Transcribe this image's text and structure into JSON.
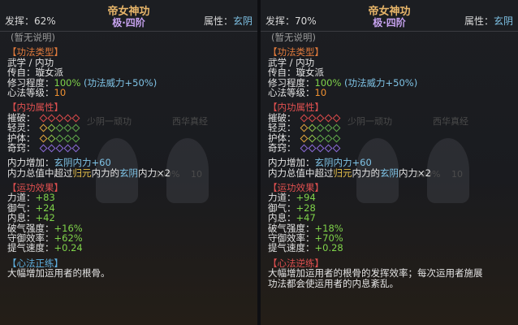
{
  "left": {
    "efficiency_label": "发挥",
    "efficiency": "62%",
    "title": "帝女神功",
    "rank": "极·四阶",
    "attr_label": "属性",
    "attr_value": "玄阴",
    "desc": "(暂无说明)",
    "type_header": "【功法类型】",
    "type_line": "武学 / 内功",
    "origin_label": "传自：",
    "origin_value": "璇女派",
    "cultivation_label": "修习程度：",
    "cultivation_value": "100%",
    "cultivation_note": "(功法威力+50%)",
    "level_label": "心法等级：",
    "level_value": "10",
    "neigong_header": "【内功属性】",
    "neigong_rows": [
      {
        "label": "摧破：",
        "colors": [
          "#d94a4a",
          "#d94a4a",
          "#d94a4a",
          "#d94a4a",
          "#d94a4a"
        ]
      },
      {
        "label": "轻灵：",
        "colors": [
          "#dfa33c",
          "#8fc34a",
          "#5fa84a",
          "#5fa84a",
          "#5fa84a"
        ]
      },
      {
        "label": "护体：",
        "colors": [
          "#dfa33c",
          "#8fc34a",
          "#5fa84a",
          "#5fa84a",
          "#5fa84a"
        ]
      },
      {
        "label": "奇窍：",
        "colors": [
          "#8a6ad6",
          "#8a6ad6",
          "#8a6ad6",
          "#8a6ad6",
          "#8a6ad6"
        ]
      }
    ],
    "neili_label": "内力增加：",
    "neili_value": "玄阴内力+60",
    "neili_line_a": "内力总值中超过",
    "neili_line_b": "归元",
    "neili_line_c": "内力的",
    "neili_line_d": "玄阴",
    "neili_line_e": "内力×2",
    "yungong_header": "【运功效果】",
    "stats": [
      {
        "label": "力道：",
        "value": "+83"
      },
      {
        "label": "御气：",
        "value": "+24"
      },
      {
        "label": "内息：",
        "value": "+42"
      },
      {
        "label": "破气强度：",
        "value": "+16%"
      },
      {
        "label": "守御效率：",
        "value": "+62%"
      },
      {
        "label": "提气速度：",
        "value": "+0.24"
      }
    ],
    "xinfa_header": "【心法正练】",
    "xinfa_text": "大幅增加运用者的根骨。",
    "bg_labels": []
  },
  "right": {
    "efficiency_label": "发挥",
    "efficiency": "70%",
    "title": "帝女神功",
    "rank": "极·四阶",
    "attr_label": "属性",
    "attr_value": "玄阴",
    "desc": "(暂无说明)",
    "type_header": "【功法类型】",
    "type_line": "武学 / 内功",
    "origin_label": "传自：",
    "origin_value": "璇女派",
    "cultivation_label": "修习程度：",
    "cultivation_value": "100%",
    "cultivation_note": "(功法威力+50%)",
    "level_label": "心法等级：",
    "level_value": "10",
    "neigong_header": "【内功属性】",
    "neigong_rows": [
      {
        "label": "摧破：",
        "colors": [
          "#d94a4a",
          "#d94a4a",
          "#d94a4a",
          "#d94a4a",
          "#d94a4a"
        ]
      },
      {
        "label": "轻灵：",
        "colors": [
          "#dfa33c",
          "#8fc34a",
          "#5fa84a",
          "#5fa84a",
          "#5fa84a"
        ]
      },
      {
        "label": "护体：",
        "colors": [
          "#dfa33c",
          "#8fc34a",
          "#5fa84a",
          "#5fa84a",
          "#5fa84a"
        ]
      },
      {
        "label": "奇窍：",
        "colors": [
          "#8a6ad6",
          "#8a6ad6",
          "#8a6ad6",
          "#8a6ad6",
          "#8a6ad6"
        ]
      }
    ],
    "neili_label": "内力增加：",
    "neili_value": "玄阴内力+60",
    "neili_line_a": "内力总值中超过",
    "neili_line_b": "归元",
    "neili_line_c": "内力的",
    "neili_line_d": "玄阴",
    "neili_line_e": "内力×2",
    "yungong_header": "【运功效果】",
    "stats": [
      {
        "label": "力道：",
        "value": "+94"
      },
      {
        "label": "御气：",
        "value": "+28"
      },
      {
        "label": "内息：",
        "value": "+47"
      },
      {
        "label": "破气强度：",
        "value": "+18%"
      },
      {
        "label": "守御效率：",
        "value": "+70%"
      },
      {
        "label": "提气速度：",
        "value": "+0.28"
      }
    ],
    "xinfa_header": "【心法逆练】",
    "xinfa_text": "大幅增加运用者的根骨的发挥效率；每次运用者施展",
    "xinfa_text2": "功法都会使运用者的内息紊乱。",
    "bg_labels": []
  },
  "background": {
    "labels": [
      "少阴一顽功",
      "西华真经",
      "100%",
      "10",
      "100%",
      "10"
    ]
  }
}
